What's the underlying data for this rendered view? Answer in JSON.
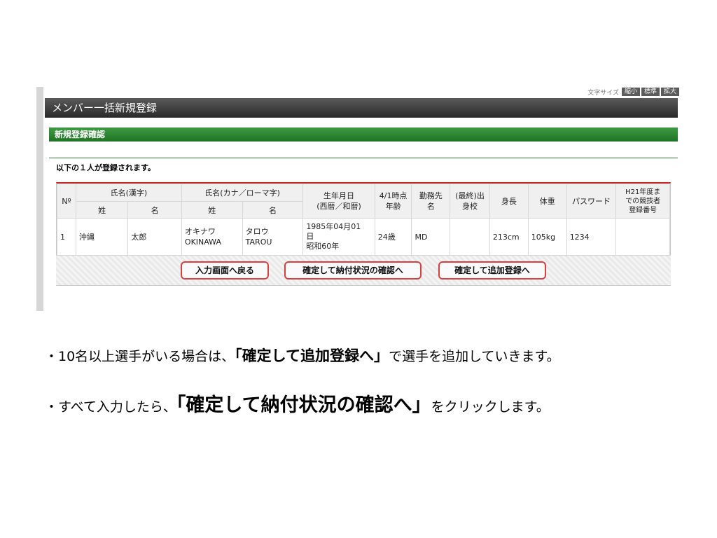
{
  "fontsize_bar": {
    "label": "文字サイズ",
    "buttons": [
      "縮小",
      "標準",
      "拡大"
    ]
  },
  "page_title": "メンバー一括新規登録",
  "section_title": "新規登録確認",
  "notice": "以下の１人が登録されます。",
  "table": {
    "headers_top": {
      "no": "Nº",
      "name_kanji": "氏名(漢字)",
      "name_kana": "氏名(カナ／ローマ字)",
      "birthdate": "生年月日\n(西暦／和暦)",
      "age": "4/1時点\n年齢",
      "workplace": "勤務先\n名",
      "school": "(最終)出\n身校",
      "height": "身長",
      "weight": "体重",
      "password": "パスワード",
      "reg_no": "H21年度ま\nでの競技者\n登録番号"
    },
    "headers_sub": {
      "sei": "姓",
      "mei": "名"
    },
    "rows": [
      {
        "no": "1",
        "sei_kanji": "沖縄",
        "mei_kanji": "太郎",
        "sei_kana": "オキナワ\nOKINAWA",
        "mei_kana": "タロウ\nTAROU",
        "birthdate": "1985年04月01\n日\n昭和60年",
        "age": "24歳",
        "workplace": "MD",
        "school": "",
        "height": "213cm",
        "weight": "105kg",
        "password": "1234",
        "reg_no": ""
      }
    ]
  },
  "buttons": {
    "back": "入力画面へ戻る",
    "confirm_payment": "確定して納付状況の確認へ",
    "confirm_add": "確定して追加登録へ"
  },
  "captions": {
    "line1": {
      "before": "・10名以上選手がいる場合は、",
      "emph": "「確定して追加登録へ」",
      "after": "で選手を追加していきます。"
    },
    "line2": {
      "before": "・すべて入力したら、",
      "emph": "「確定して納付状況の確認へ」",
      "after": "をクリックします。"
    }
  },
  "colors": {
    "title_bar": "#2a2a2a",
    "section_bar": "#1d7422",
    "button_border": "#d84040",
    "table_top_border": "#c62828"
  }
}
